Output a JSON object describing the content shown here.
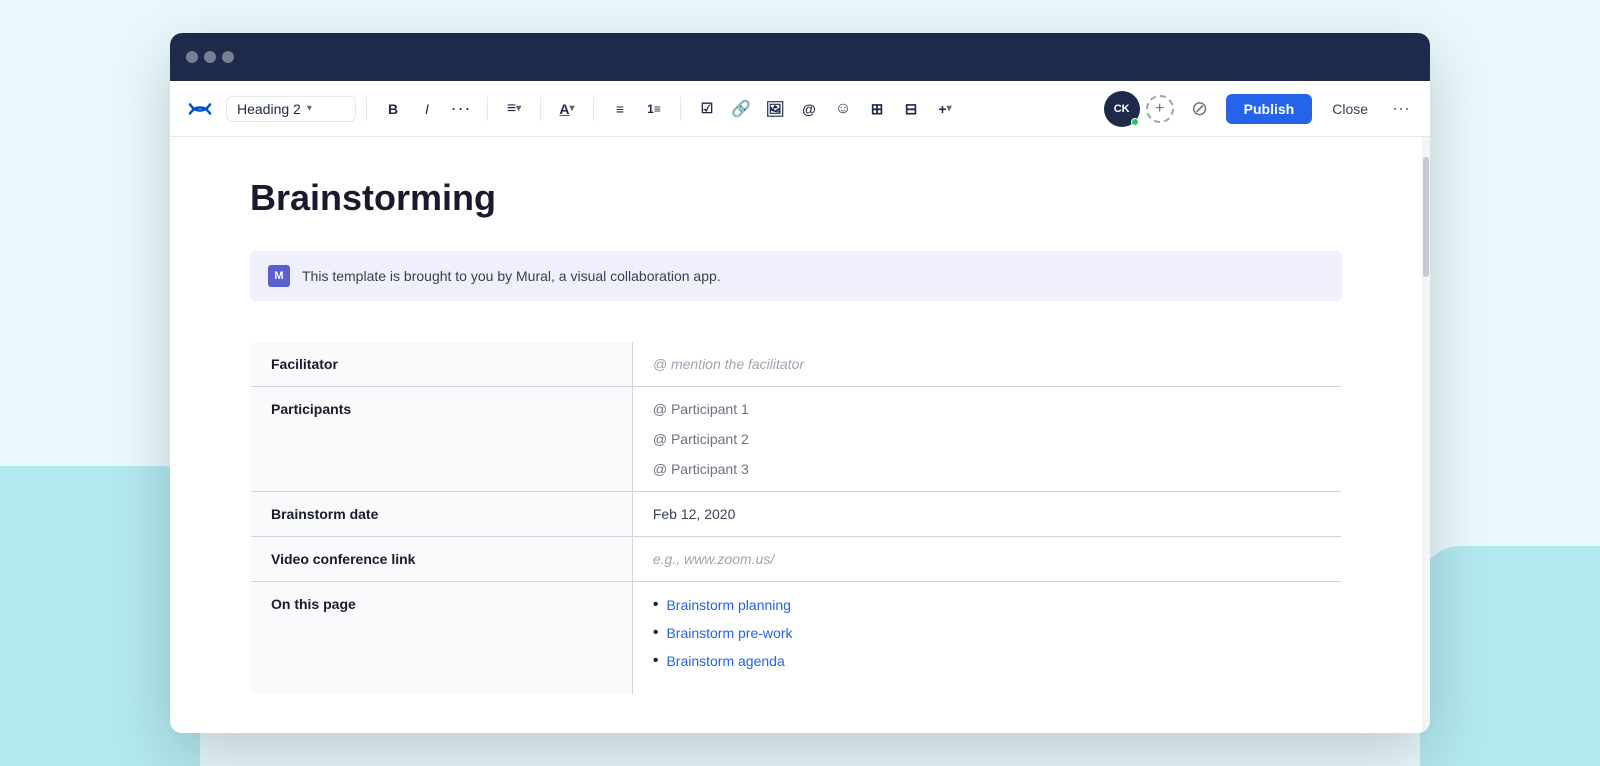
{
  "window": {
    "titlebar": {
      "dots": [
        "dot1",
        "dot2",
        "dot3"
      ]
    }
  },
  "toolbar": {
    "logo_label": "Confluence",
    "heading_selector": "Heading 2",
    "bold_label": "B",
    "italic_label": "I",
    "more_label": "···",
    "align_label": "≡",
    "text_color_label": "A",
    "unordered_list_label": "☰",
    "ordered_list_label": "☰",
    "task_list_label": "☑",
    "link_label": "🔗",
    "image_label": "🖼",
    "mention_label": "@",
    "emoji_label": "☺",
    "table_label": "⊞",
    "columns_label": "⊟",
    "insert_label": "+",
    "avatar_initials": "CK",
    "add_label": "+",
    "version_label": "⊘",
    "publish_label": "Publish",
    "close_label": "Close",
    "more_options_label": "···"
  },
  "document": {
    "title": "Brainstorming",
    "banner_text": "This template is brought to you by Mural, a visual collaboration app.",
    "banner_icon": "M",
    "table": {
      "rows": [
        {
          "label": "Facilitator",
          "value": "@ mention the facilitator",
          "type": "text"
        },
        {
          "label": "Participants",
          "type": "participants",
          "values": [
            "@ Participant 1",
            "@ Participant 2",
            "@ Participant 3"
          ]
        },
        {
          "label": "Brainstorm date",
          "value": "Feb 12, 2020",
          "type": "text"
        },
        {
          "label": "Video conference link",
          "value": "e.g., www.zoom.us/",
          "type": "text"
        },
        {
          "label": "On this page",
          "type": "links",
          "links": [
            {
              "text": "Brainstorm planning"
            },
            {
              "text": "Brainstorm pre-work"
            },
            {
              "text": "Brainstorm agenda"
            }
          ]
        }
      ]
    }
  }
}
